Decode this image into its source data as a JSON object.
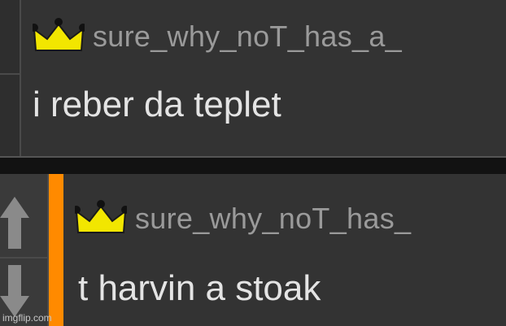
{
  "comments": [
    {
      "username": "sure_why_noT_has_a_",
      "message": "i reber da teplet",
      "badge": "crown-icon"
    },
    {
      "username": "sure_why_noT_has_",
      "message": "t harvin a stoak",
      "badge": "crown-icon"
    }
  ],
  "watermark": "imgflip.com",
  "colors": {
    "accent": "#ff8a00",
    "crown": "#f2e600",
    "username": "#9a9a9a",
    "message": "#e4e4e4"
  }
}
